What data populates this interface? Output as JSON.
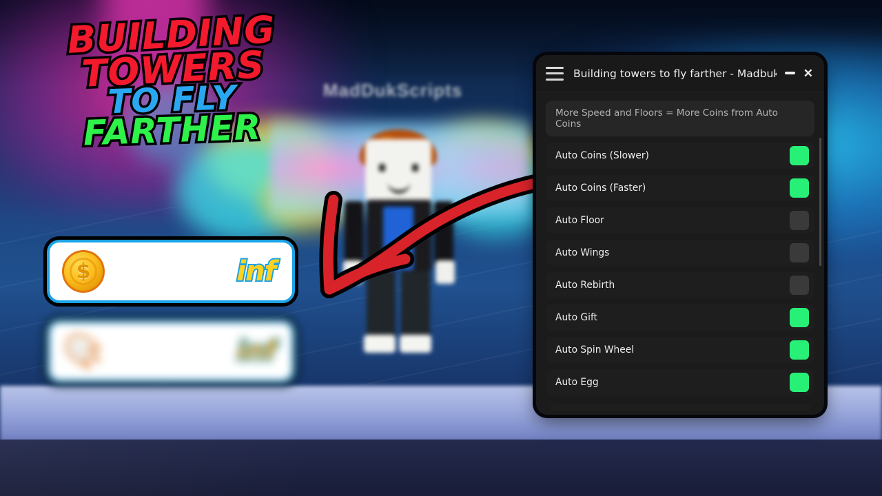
{
  "thumbnail": {
    "title_line1": "BUILDING TOWERS",
    "title_line2": "TO FLY",
    "title_line3": "FARTHER",
    "watermark": "MadDukScripts",
    "colors": {
      "line1": "#f31a2e",
      "line2": "#2aa7f2",
      "line3": "#2ef24a",
      "arrow": "#d8232a"
    }
  },
  "stat_cards": [
    {
      "icon": "coin-icon",
      "symbol": "$",
      "value": "inf"
    },
    {
      "icon": "wing-icon",
      "symbol": "",
      "value": "inf"
    }
  ],
  "panel": {
    "titlebar": {
      "menu_icon": "hamburger-icon",
      "title": "Building towers to fly farther - Madbuk Scripts",
      "minimize_label": "—",
      "close_label": "✕"
    },
    "info_banner": "More Speed and Floors = More Coins from Auto Coins",
    "toggles": [
      {
        "label": "Auto Coins (Slower)",
        "state": "on"
      },
      {
        "label": "Auto Coins (Faster)",
        "state": "on"
      },
      {
        "label": "Auto Floor",
        "state": "off"
      },
      {
        "label": "Auto Wings",
        "state": "off"
      },
      {
        "label": "Auto Rebirth",
        "state": "off"
      },
      {
        "label": "Auto Gift",
        "state": "on"
      },
      {
        "label": "Auto Spin Wheel",
        "state": "on"
      },
      {
        "label": "Auto Egg",
        "state": "on"
      }
    ],
    "colors": {
      "toggle_on": "#28f077",
      "toggle_off": "#3a3a3a",
      "panel_bg": "#1b1b1b",
      "row_bg": "#1e1e1e"
    }
  }
}
